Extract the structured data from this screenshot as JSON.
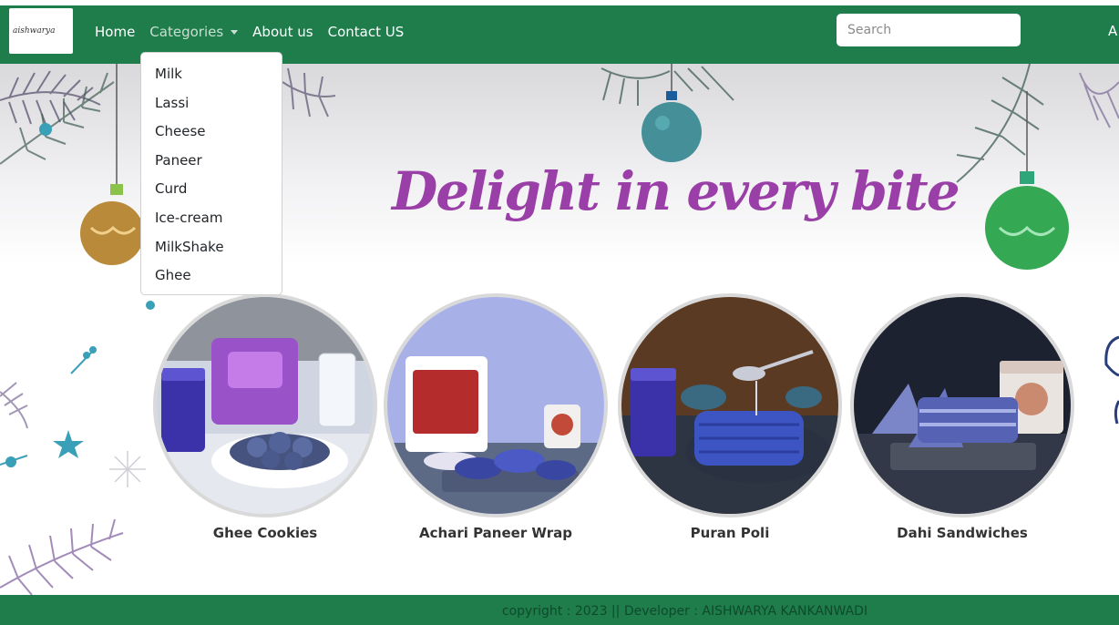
{
  "navbar": {
    "logo_text": "aishwarya",
    "links": {
      "home": "Home",
      "categories": "Categories",
      "about": "About us",
      "contact": "Contact US"
    },
    "search_placeholder": "Search",
    "edge_text": "A",
    "colors": {
      "bar": "#1f7d4c",
      "link": "#ffffff"
    }
  },
  "dropdown": {
    "items": [
      "Milk",
      "Lassi",
      "Cheese",
      "Paneer",
      "Curd",
      "Ice-cream",
      "MilkShake",
      "Ghee"
    ]
  },
  "hero": {
    "headline": "Delight in every bite",
    "headline_color": "#9a3fa7"
  },
  "products": [
    {
      "name": "Ghee Cookies"
    },
    {
      "name": "Achari Paneer Wrap"
    },
    {
      "name": "Puran Poli"
    },
    {
      "name": "Dahi Sandwiches"
    }
  ],
  "footer": {
    "text": "copyright : 2023 || Developer : AISHWARYA KANKANWADI"
  }
}
